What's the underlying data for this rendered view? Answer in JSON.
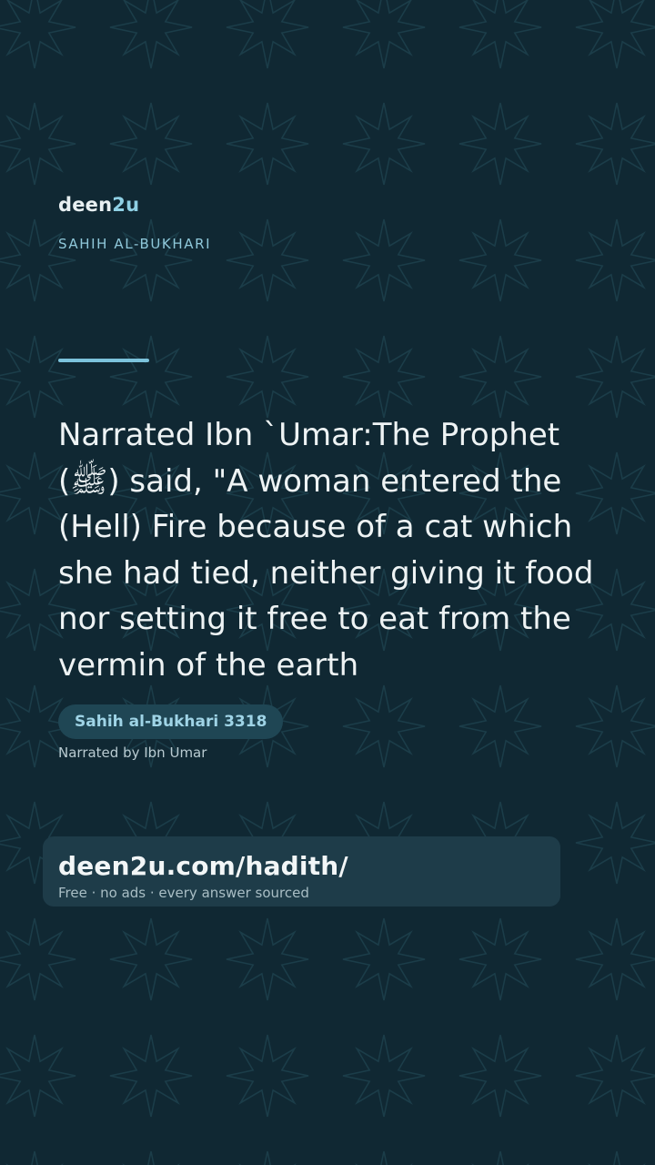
{
  "brand": {
    "name_prefix": "deen",
    "name_suffix": "2u"
  },
  "collection": "SAHIH AL-BUKHARI",
  "hadith": {
    "text": "Narrated Ibn `Umar:The Prophet (ﷺ) said, \"A woman entered the (Hell) Fire because of a cat which she had tied, neither giving it food nor setting it free to eat from the vermin of the earth",
    "reference": "Sahih al-Bukhari 3318",
    "narrator": "Narrated by Ibn Umar"
  },
  "cta": {
    "url": "deen2u.com/hadith/",
    "tagline": "Free · no ads · every answer sourced"
  },
  "colors": {
    "background": "#102833",
    "accent": "#8fd0e4",
    "badge_bg": "#1f4654",
    "card_bg": "#1e3c49",
    "text": "#eef3f4"
  },
  "icons": {
    "background_pattern": "eight-point-star-pattern"
  }
}
